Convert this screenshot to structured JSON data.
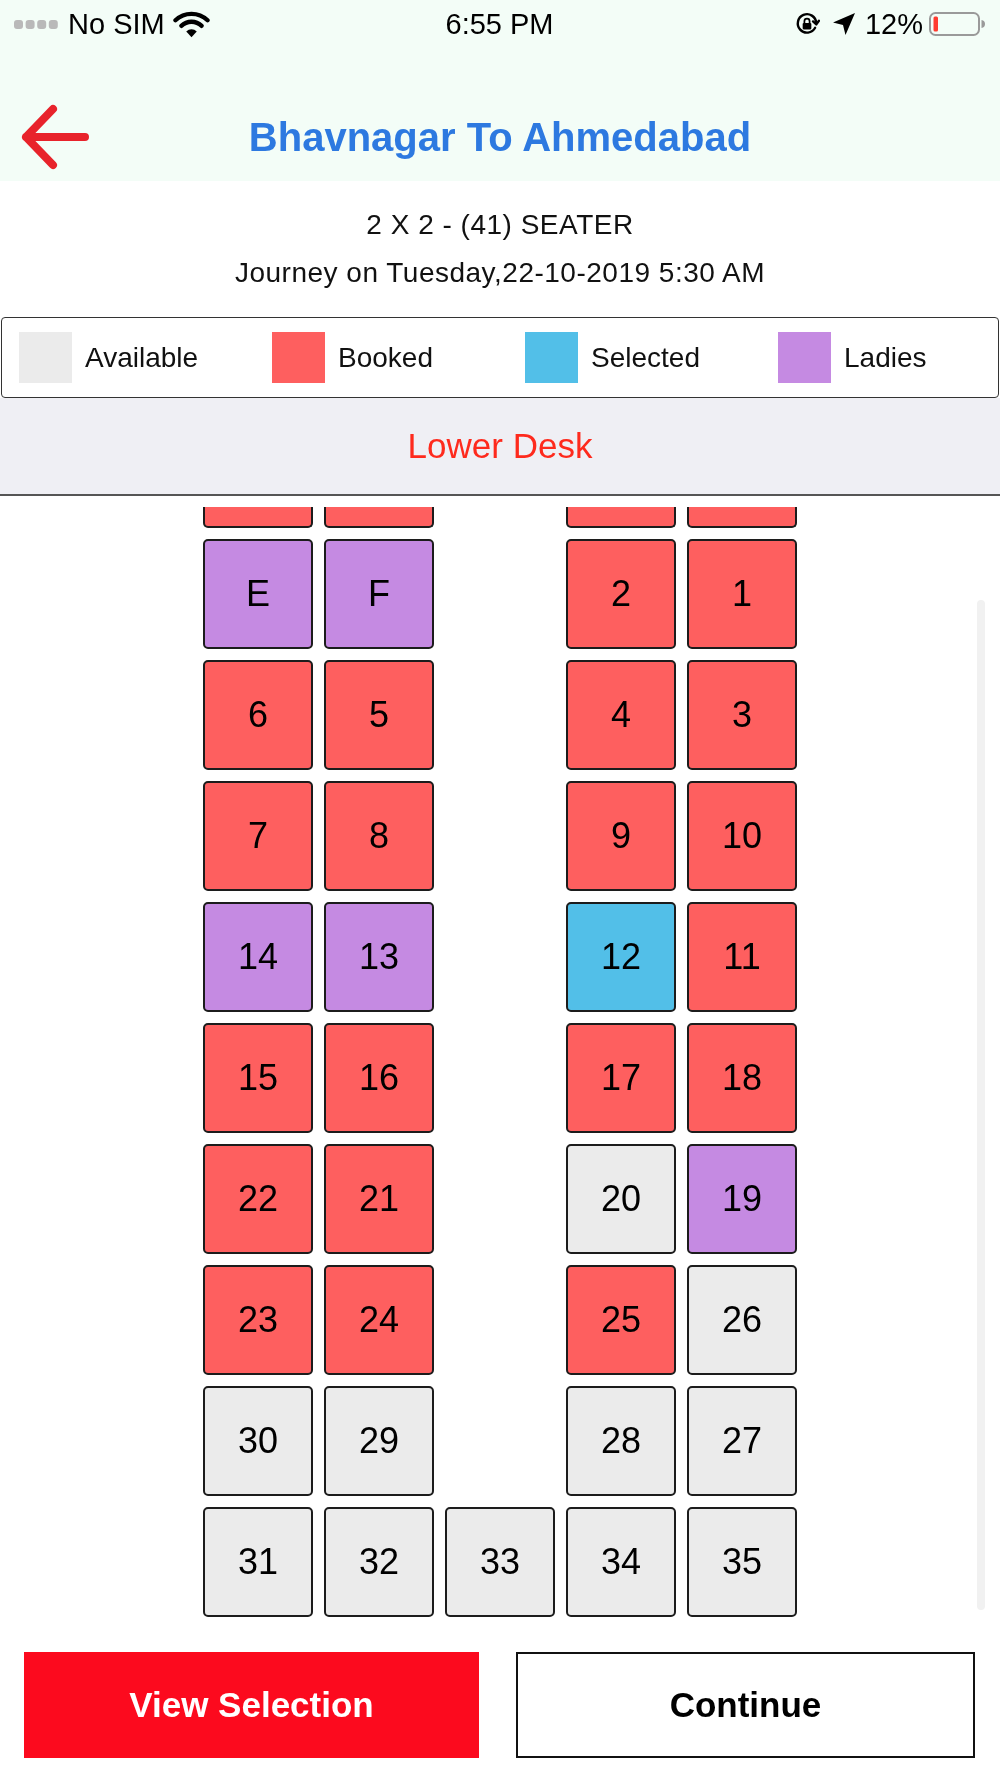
{
  "status_bar": {
    "carrier": "No SIM",
    "time": "6:55 PM",
    "battery": "12%"
  },
  "header": {
    "title": "Bhavnagar To Ahmedabad"
  },
  "bus": {
    "type": "2 X 2 - (41) SEATER",
    "journey": "Journey on Tuesday,22-10-2019 5:30 AM"
  },
  "legend": [
    {
      "kind": "available",
      "label": "Available",
      "color": "#ebebeb"
    },
    {
      "kind": "booked",
      "label": "Booked",
      "color": "#fe5f5f"
    },
    {
      "kind": "selected",
      "label": "Selected",
      "color": "#52bfe8"
    },
    {
      "kind": "ladies",
      "label": "Ladies",
      "color": "#c58ae2"
    }
  ],
  "deck": {
    "title": "Lower Desk"
  },
  "seat_map": {
    "rows": [
      {
        "kind": "cut",
        "seats": [
          {
            "kind": "booked"
          },
          {
            "kind": "booked"
          },
          {
            "kind": "aisle"
          },
          {
            "kind": "booked"
          },
          {
            "kind": "booked"
          }
        ]
      },
      {
        "kind": "full",
        "seats": [
          {
            "kind": "ladies",
            "label": "E"
          },
          {
            "kind": "ladies",
            "label": "F"
          },
          {
            "kind": "aisle"
          },
          {
            "kind": "booked",
            "label": "2"
          },
          {
            "kind": "booked",
            "label": "1"
          }
        ]
      },
      {
        "kind": "full",
        "seats": [
          {
            "kind": "booked",
            "label": "6"
          },
          {
            "kind": "booked",
            "label": "5"
          },
          {
            "kind": "aisle"
          },
          {
            "kind": "booked",
            "label": "4"
          },
          {
            "kind": "booked",
            "label": "3"
          }
        ]
      },
      {
        "kind": "full",
        "seats": [
          {
            "kind": "booked",
            "label": "7"
          },
          {
            "kind": "booked",
            "label": "8"
          },
          {
            "kind": "aisle"
          },
          {
            "kind": "booked",
            "label": "9"
          },
          {
            "kind": "booked",
            "label": "10"
          }
        ]
      },
      {
        "kind": "full",
        "seats": [
          {
            "kind": "ladies",
            "label": "14"
          },
          {
            "kind": "ladies",
            "label": "13"
          },
          {
            "kind": "aisle"
          },
          {
            "kind": "selected",
            "label": "12"
          },
          {
            "kind": "booked",
            "label": "11"
          }
        ]
      },
      {
        "kind": "full",
        "seats": [
          {
            "kind": "booked",
            "label": "15"
          },
          {
            "kind": "booked",
            "label": "16"
          },
          {
            "kind": "aisle"
          },
          {
            "kind": "booked",
            "label": "17"
          },
          {
            "kind": "booked",
            "label": "18"
          }
        ]
      },
      {
        "kind": "full",
        "seats": [
          {
            "kind": "booked",
            "label": "22"
          },
          {
            "kind": "booked",
            "label": "21"
          },
          {
            "kind": "aisle"
          },
          {
            "kind": "available",
            "label": "20"
          },
          {
            "kind": "ladies",
            "label": "19"
          }
        ]
      },
      {
        "kind": "full",
        "seats": [
          {
            "kind": "booked",
            "label": "23"
          },
          {
            "kind": "booked",
            "label": "24"
          },
          {
            "kind": "aisle"
          },
          {
            "kind": "booked",
            "label": "25"
          },
          {
            "kind": "available",
            "label": "26"
          }
        ]
      },
      {
        "kind": "full",
        "seats": [
          {
            "kind": "available",
            "label": "30"
          },
          {
            "kind": "available",
            "label": "29"
          },
          {
            "kind": "aisle"
          },
          {
            "kind": "available",
            "label": "28"
          },
          {
            "kind": "available",
            "label": "27"
          }
        ]
      },
      {
        "kind": "full",
        "seats": [
          {
            "kind": "available",
            "label": "31"
          },
          {
            "kind": "available",
            "label": "32"
          },
          {
            "kind": "available",
            "label": "33"
          },
          {
            "kind": "available",
            "label": "34"
          },
          {
            "kind": "available",
            "label": "35"
          }
        ]
      }
    ]
  },
  "buttons": [
    {
      "kind": "primary",
      "label": "View Selection"
    },
    {
      "kind": "outline",
      "label": "Continue"
    }
  ]
}
